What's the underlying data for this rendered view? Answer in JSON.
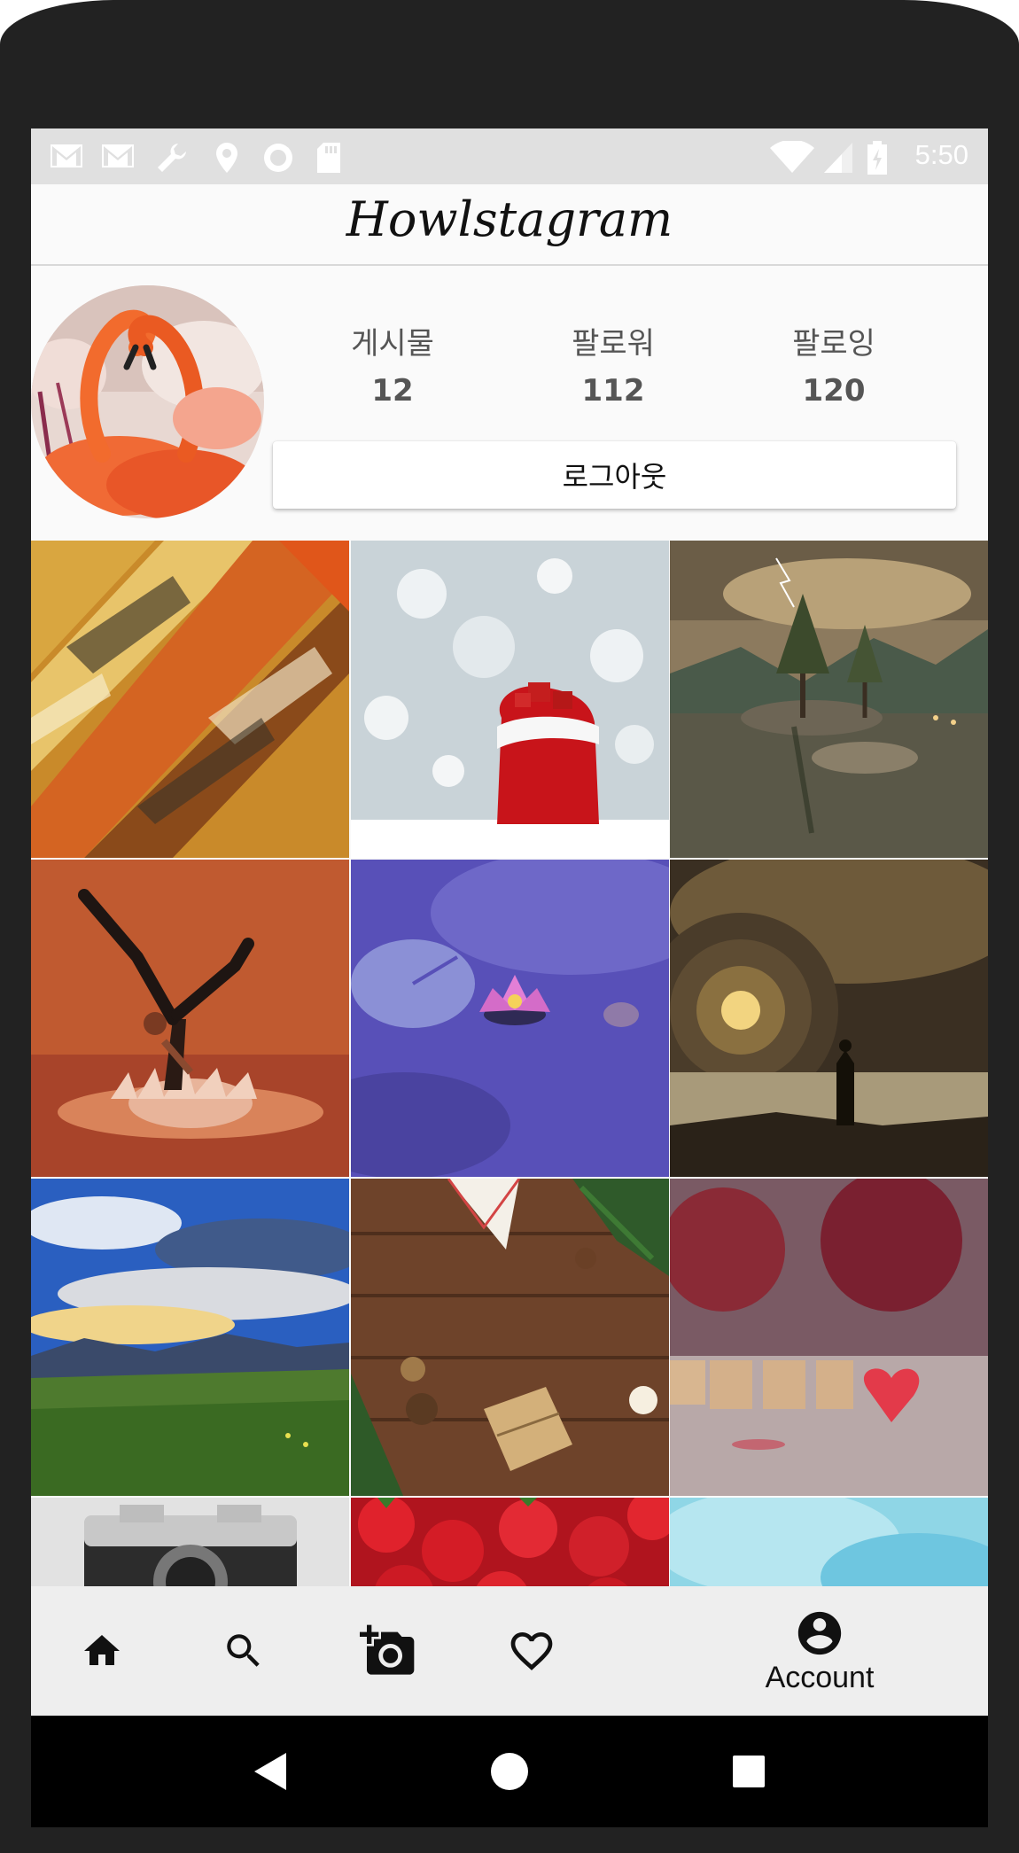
{
  "status_bar": {
    "time": "5:50",
    "left_icons": [
      "gmail-icon",
      "gmail-icon",
      "wrench-icon",
      "location-icon",
      "circle-icon",
      "sd-card-icon"
    ],
    "right_icons": [
      "wifi-icon",
      "signal-icon",
      "battery-charging-icon"
    ]
  },
  "toolbar": {
    "title": "Howlstagram"
  },
  "profile": {
    "stats": [
      {
        "label": "게시물",
        "count": "12"
      },
      {
        "label": "팔로워",
        "count": "112"
      },
      {
        "label": "팔로잉",
        "count": "120"
      }
    ],
    "logout_label": "로그아웃"
  },
  "grid": {
    "photos": [
      "abstract-paint",
      "christmas-gift-bag",
      "lake-tree-lightning",
      "yoga-splash",
      "water-lily",
      "tunnel-silhouette",
      "sky-meadow",
      "christmas-wood-table",
      "love-tiles",
      "vintage-camera",
      "strawberries",
      "blue-watercolor"
    ]
  },
  "bottom_nav": {
    "items": [
      {
        "icon": "home-icon"
      },
      {
        "icon": "search-icon"
      },
      {
        "icon": "add-photo-icon"
      },
      {
        "icon": "heart-icon"
      },
      {
        "icon": "account-icon",
        "label": "Account",
        "selected": true
      }
    ]
  },
  "system_nav": {
    "buttons": [
      "back-icon",
      "home-circle-icon",
      "recents-icon"
    ]
  },
  "colors": {
    "status_bar": "#e0e0e0",
    "toolbar": "#fafafa",
    "bottom_nav": "#eeeeee",
    "frame": "#222222"
  }
}
